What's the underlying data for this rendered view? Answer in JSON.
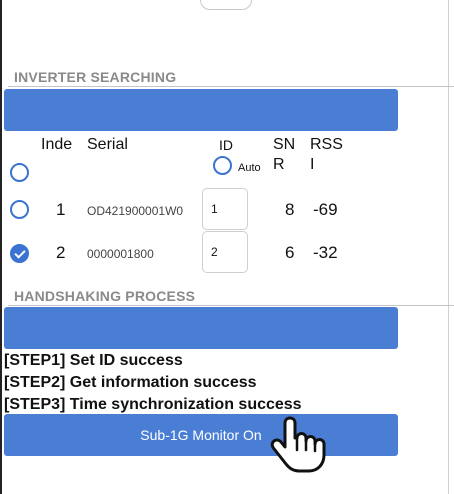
{
  "inverter_section": {
    "title": "INVERTER SEARCHING",
    "columns": {
      "index": "Inde",
      "serial": "Serial",
      "id": "ID",
      "auto": "Auto",
      "snr_line1": "SN",
      "snr_line2": "R",
      "rssi_line1": "RSS",
      "rssi_line2": "I"
    },
    "rows": [
      {
        "index": "1",
        "serial": "OD421900001W0",
        "id": "1",
        "snr": "8",
        "rssi": "-69",
        "selected": false
      },
      {
        "index": "2",
        "serial": "0000001800",
        "id": "2",
        "snr": "6",
        "rssi": "-32",
        "selected": true
      }
    ]
  },
  "handshaking_section": {
    "title": "HANDSHAKING PROCESS",
    "steps": [
      "[STEP1] Set ID success",
      "[STEP2] Get information success",
      "[STEP3] Time synchronization success"
    ]
  },
  "monitor_button": {
    "label": "Sub-1G Monitor On"
  },
  "colors": {
    "accent": "#4a7ed4",
    "header_text": "#8a8a8a",
    "radio": "#3a73d1"
  },
  "icons": {
    "pointer": "hand-pointer-icon"
  }
}
